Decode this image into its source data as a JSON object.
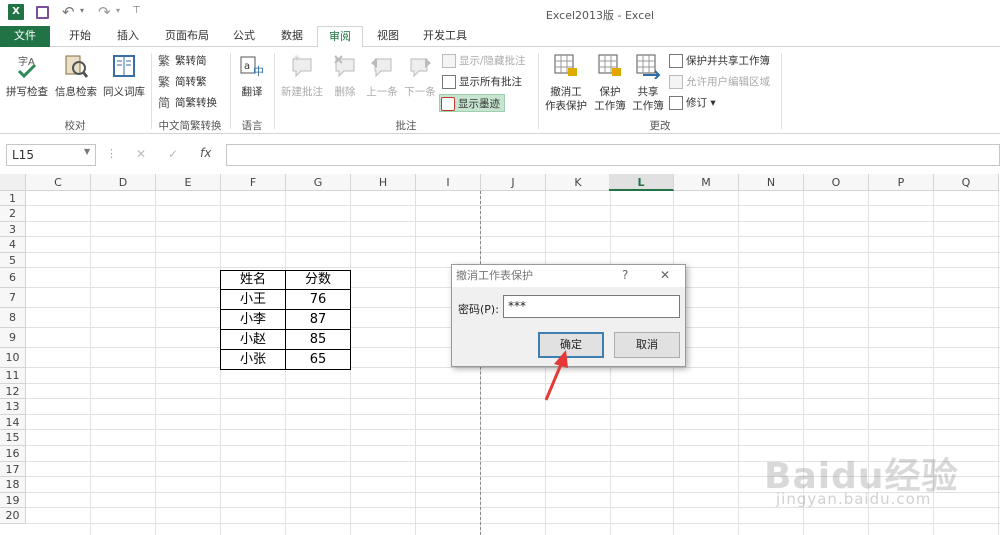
{
  "app": {
    "title": "Excel2013版 - Excel"
  },
  "tabs": [
    "文件",
    "开始",
    "插入",
    "页面布局",
    "公式",
    "数据",
    "审阅",
    "视图",
    "开发工具"
  ],
  "ribbon": {
    "proofing": {
      "spell": "拼写检查",
      "research": "信息检索",
      "thesaurus": "同义词库",
      "group": "校对"
    },
    "chinese": {
      "to_simplified": "繁转简",
      "to_traditional": "简转繁",
      "convert": "简繁转换",
      "group": "中文简繁转换"
    },
    "language": {
      "translate": "翻译",
      "group": "语言"
    },
    "comments": {
      "new": "新建批注",
      "delete": "删除",
      "prev": "上一条",
      "next": "下一条",
      "show_hide": "显示/隐藏批注",
      "show_all": "显示所有批注",
      "show_ink": "显示墨迹",
      "group": "批注"
    },
    "changes": {
      "unprotect_sheet_1": "撤消工",
      "unprotect_sheet_2": "作表保护",
      "protect_wb_1": "保护",
      "protect_wb_2": "工作簿",
      "share_wb_1": "共享",
      "share_wb_2": "工作簿",
      "protect_share": "保护并共享工作簿",
      "allow_edit": "允许用户编辑区域",
      "track": "修订",
      "group": "更改"
    }
  },
  "formula_bar": {
    "name_box": "L15",
    "fx": "fx",
    "cancel": "✕",
    "enter": "✓",
    "value": ""
  },
  "columns": [
    "C",
    "D",
    "E",
    "F",
    "G",
    "H",
    "I",
    "J",
    "K",
    "L",
    "M",
    "N",
    "O",
    "P",
    "Q"
  ],
  "selected_column": "L",
  "rows": [
    "1",
    "2",
    "3",
    "4",
    "5",
    "6",
    "7",
    "8",
    "9",
    "10",
    "11",
    "12",
    "13",
    "14",
    "15",
    "16",
    "17",
    "18",
    "19",
    "20"
  ],
  "table": {
    "header": [
      "姓名",
      "分数"
    ],
    "rows": [
      [
        "小王",
        "76"
      ],
      [
        "小李",
        "87"
      ],
      [
        "小赵",
        "85"
      ],
      [
        "小张",
        "65"
      ]
    ]
  },
  "dialog": {
    "title": "撤消工作表保护",
    "help": "?",
    "close": "✕",
    "password_label": "密码(P):",
    "password_value": "***",
    "ok": "确定",
    "cancel": "取消"
  },
  "watermark": {
    "brand": "Baidu经验",
    "url": "jingyan.baidu.com"
  },
  "colors": {
    "excel_green": "#217346",
    "arrow_red": "#e53935"
  }
}
